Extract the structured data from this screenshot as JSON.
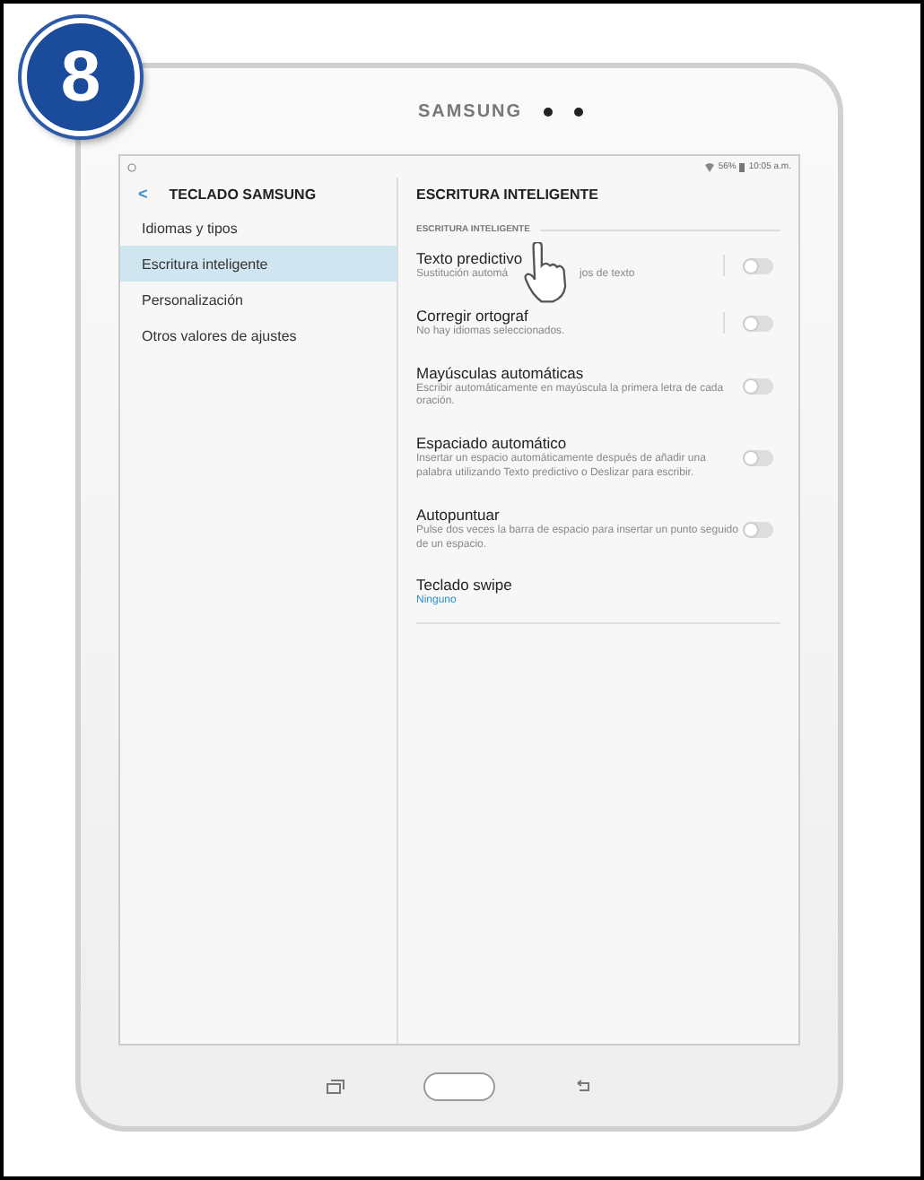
{
  "step_badge": "8",
  "device": {
    "brand": "SAMSUNG"
  },
  "status_bar": {
    "battery": "56%",
    "time": "10:05 a.m."
  },
  "left_panel": {
    "title": "TECLADO SAMSUNG",
    "back": "<",
    "items": [
      {
        "label": "Idiomas y tipos",
        "selected": false
      },
      {
        "label": "Escritura inteligente",
        "selected": true
      },
      {
        "label": "Personalización",
        "selected": false
      },
      {
        "label": "Otros valores de ajustes",
        "selected": false
      }
    ]
  },
  "right_panel": {
    "title": "ESCRITURA INTELIGENTE",
    "section": "ESCRITURA INTELIGENTE",
    "settings": [
      {
        "kind": "toggle",
        "title": "Texto predictivo",
        "summary": [
          "Sustitución automá",
          "jos de texto"
        ],
        "on": false,
        "separator": true
      },
      {
        "kind": "toggle",
        "title": "Corregir ortograf",
        "summary": [
          "No hay idiomas seleccionados."
        ],
        "on": false,
        "separator": true
      },
      {
        "kind": "toggle",
        "title": "Mayúsculas automáticas",
        "summary": [
          "Escribir automáticamente en mayúscula la primera letra de cada oración."
        ],
        "on": false,
        "separator": false
      },
      {
        "kind": "toggle",
        "title": "Espaciado automático",
        "summary": [
          "Insertar un espacio automáticamente después de añadir una palabra utilizando Texto predictivo o Deslizar para escribir."
        ],
        "on": false,
        "separator": false
      },
      {
        "kind": "toggle",
        "title": "Autopuntuar",
        "summary": [
          "Pulse dos veces la barra de espacio para insertar un punto seguido de un espacio."
        ],
        "on": false,
        "separator": false
      },
      {
        "kind": "value",
        "title": "Teclado swipe",
        "summary": [
          "Ninguno"
        ]
      }
    ]
  }
}
